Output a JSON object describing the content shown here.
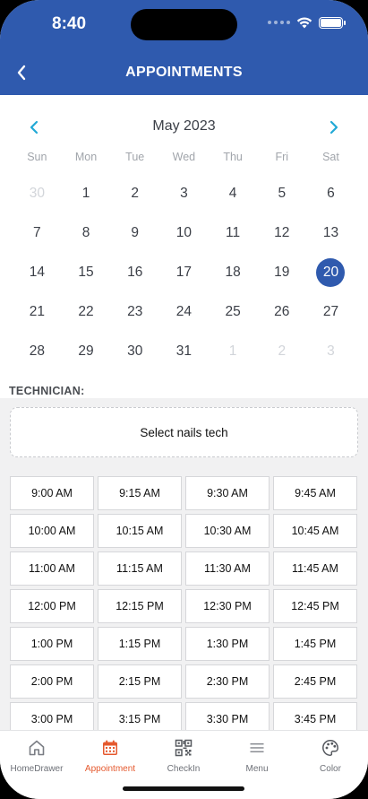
{
  "status": {
    "time": "8:40"
  },
  "header": {
    "title": "APPOINTMENTS"
  },
  "calendar": {
    "month": "May 2023",
    "weekdays": [
      "Sun",
      "Mon",
      "Tue",
      "Wed",
      "Thu",
      "Fri",
      "Sat"
    ],
    "weeks": [
      [
        "30",
        "1",
        "2",
        "3",
        "4",
        "5",
        "6"
      ],
      [
        "7",
        "8",
        "9",
        "10",
        "11",
        "12",
        "13"
      ],
      [
        "14",
        "15",
        "16",
        "17",
        "18",
        "19",
        "20"
      ],
      [
        "21",
        "22",
        "23",
        "24",
        "25",
        "26",
        "27"
      ],
      [
        "28",
        "29",
        "30",
        "31",
        "1",
        "2",
        "3"
      ]
    ],
    "selected": "20"
  },
  "technician": {
    "label": "TECHNICIAN:",
    "placeholder": "Select nails tech"
  },
  "slots": [
    "9:00 AM",
    "9:15 AM",
    "9:30 AM",
    "9:45 AM",
    "10:00 AM",
    "10:15 AM",
    "10:30 AM",
    "10:45 AM",
    "11:00 AM",
    "11:15 AM",
    "11:30 AM",
    "11:45 AM",
    "12:00 PM",
    "12:15 PM",
    "12:30 PM",
    "12:45 PM",
    "1:00 PM",
    "1:15 PM",
    "1:30 PM",
    "1:45 PM",
    "2:00 PM",
    "2:15 PM",
    "2:30 PM",
    "2:45 PM",
    "3:00 PM",
    "3:15 PM",
    "3:30 PM",
    "3:45 PM"
  ],
  "tabs": [
    {
      "label": "HomeDrawer",
      "icon": "home-icon"
    },
    {
      "label": "Appointment",
      "icon": "calendar-icon",
      "active": true
    },
    {
      "label": "CheckIn",
      "icon": "qr-code-icon"
    },
    {
      "label": "Menu",
      "icon": "menu-icon"
    },
    {
      "label": "Color",
      "icon": "palette-icon"
    }
  ],
  "colors": {
    "primary": "#2f5aae",
    "accent": "#22a9d6",
    "active_tab": "#e5592e"
  }
}
